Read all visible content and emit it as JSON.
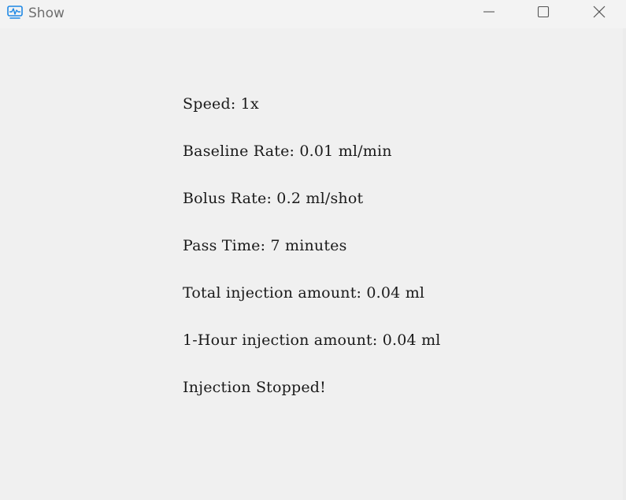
{
  "window": {
    "title": "Show",
    "icon": "activity-monitor-icon",
    "accent_color": "#1e88e5"
  },
  "controls": {
    "minimize": "minimize-icon",
    "maximize": "maximize-icon",
    "close": "close-icon"
  },
  "info": {
    "speed": "Speed: 1x",
    "baseline_rate": "Baseline Rate: 0.01 ml/min",
    "bolus_rate": "Bolus Rate: 0.2 ml/shot",
    "pass_time": "Pass Time: 7 minutes",
    "total_injection": "Total injection amount: 0.04 ml",
    "hour_injection": "1-Hour injection amount: 0.04 ml",
    "status": "Injection Stopped!"
  }
}
